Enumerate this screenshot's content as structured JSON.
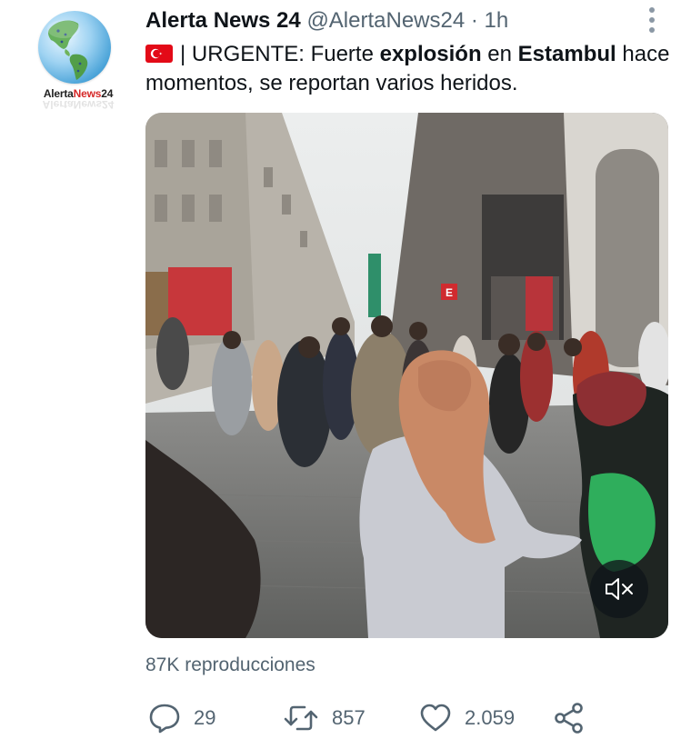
{
  "account": {
    "display_name": "Alerta News 24",
    "handle": "@AlertaNews24",
    "separator": "·",
    "time": "1h",
    "avatar_brand": "AlertaNews24",
    "avatar_brand_prefix": "Alerta",
    "avatar_brand_word": "News",
    "avatar_brand_num": "24"
  },
  "tweet": {
    "flag_icon": "turkey-flag-icon",
    "t1": "| URGENTE: Fuerte ",
    "t2": "explosión",
    "t3": " en ",
    "t4": "Estambul",
    "t5": " hace momentos, se reportan varios heridos."
  },
  "media": {
    "mute_icon": "speaker-muted-icon",
    "storefront_sign": "E"
  },
  "views_text": "87K reproducciones",
  "actions": {
    "reply_count": "29",
    "retweet_count": "857",
    "like_count": "2.059"
  },
  "colors": {
    "text_primary": "#0f1419",
    "text_secondary": "#536471",
    "flag_red": "#e30a17",
    "brand_red": "#d62828"
  }
}
